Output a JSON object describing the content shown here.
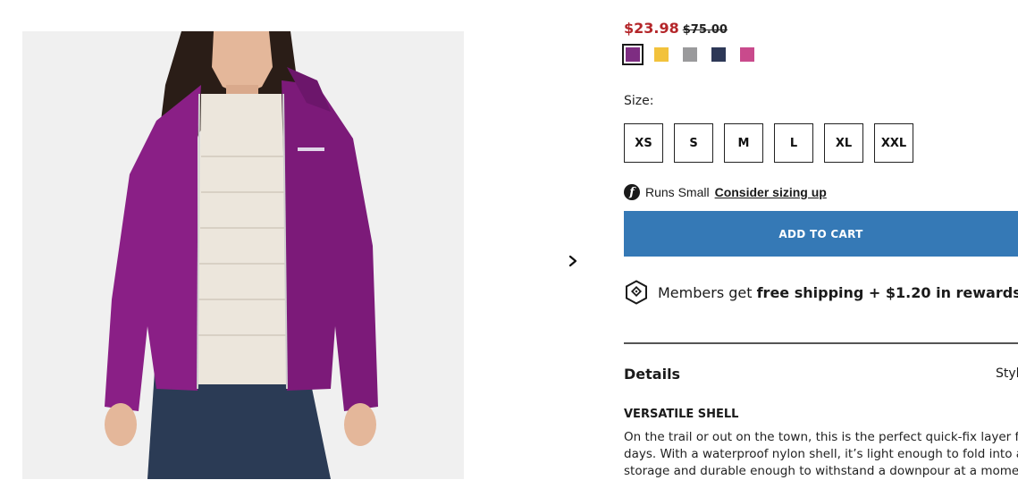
{
  "product_image": {
    "alt": "Women's purple rain jacket over white layer and jeans",
    "colors": {
      "background": "#f0f0f0",
      "jacket": "#8a1f86",
      "inner": "#ece6dc",
      "jeans": "#2b3b55",
      "skin": "#e4b79a",
      "hair": "#2a1d17"
    }
  },
  "gallery": {
    "next_icon": "chevron-right-icon"
  },
  "price": {
    "sale": "$23.98",
    "original": "$75.00",
    "sale_color": "#b4262a"
  },
  "swatches": [
    {
      "color": "#7e2d82",
      "selected": true
    },
    {
      "color": "#f2c23c",
      "selected": false
    },
    {
      "color": "#9a9a9c",
      "selected": false
    },
    {
      "color": "#2d3857",
      "selected": false
    },
    {
      "color": "#c94a8c",
      "selected": false
    }
  ],
  "size": {
    "label": "Size:",
    "options": [
      "XS",
      "S",
      "M",
      "L",
      "XL",
      "XXL"
    ]
  },
  "fit": {
    "icon_glyph": "f",
    "text": "Runs Small",
    "link": "Consider sizing up"
  },
  "cart": {
    "button_label": "ADD TO CART",
    "color": "#3579b6"
  },
  "members": {
    "prefix": "Members get ",
    "bold": "free shipping + $1.20 in rewards"
  },
  "details": {
    "title": "Details",
    "style_label": "Style",
    "feature_heading": "VERSATILE SHELL",
    "description_lines": [
      "On the trail or out on the town, this is the perfect quick-fix layer for u",
      "days. With a waterproof nylon shell, it’s light enough to fold into a po",
      "storage and durable enough to withstand a downpour at a moment’"
    ]
  }
}
